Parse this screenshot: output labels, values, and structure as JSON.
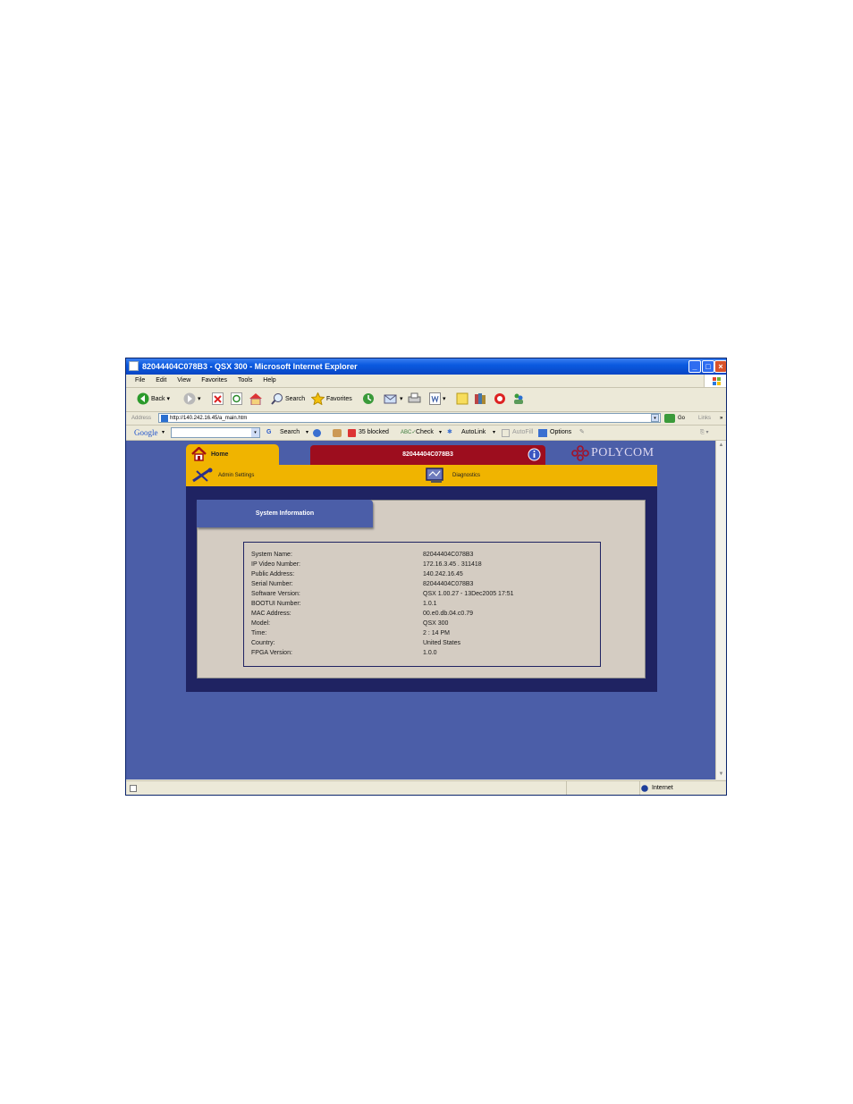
{
  "window": {
    "title": "82044404C078B3 - QSX 300 - Microsoft Internet Explorer",
    "min": "_",
    "max": "□",
    "close": "×"
  },
  "menu": [
    "File",
    "Edit",
    "View",
    "Favorites",
    "Tools",
    "Help"
  ],
  "toolbar": {
    "back": "Back",
    "search": "Search",
    "favorites": "Favorites"
  },
  "address": {
    "label": "Address",
    "url": "http://140.242.16.45/a_main.htm",
    "go": "Go",
    "links": "Links",
    "more": "»"
  },
  "google_bar": {
    "brand": "Google",
    "search": "Search",
    "blocked": "35 blocked",
    "check": "Check",
    "autolink": "AutoLink",
    "autofill": "AutoFill",
    "options": "Options"
  },
  "status": {
    "zone": "Internet"
  },
  "app": {
    "home_tab": "Home",
    "system_tab": "82044404C078B3",
    "logo": "POLYCOM",
    "nav": {
      "admin": "Admin Settings",
      "diagnostics": "Diagnostics"
    },
    "section_title": "System Information",
    "info": [
      {
        "label": "System Name:",
        "value": "82044404C078B3"
      },
      {
        "label": "IP Video Number:",
        "value": "172.16.3.45 . 311418"
      },
      {
        "label": "Public Address:",
        "value": "140.242.16.45"
      },
      {
        "label": "Serial Number:",
        "value": "82044404C078B3"
      },
      {
        "label": "Software Version:",
        "value": "QSX 1.00.27 - 13Dec2005 17:51"
      },
      {
        "label": "BOOTUI Number:",
        "value": "1.0.1"
      },
      {
        "label": "MAC Address:",
        "value": "00.e0.db.04.c0.79"
      },
      {
        "label": "Model:",
        "value": "QSX 300"
      },
      {
        "label": "Time:",
        "value": "2 : 14 PM"
      },
      {
        "label": "Country:",
        "value": "United States"
      },
      {
        "label": "FPGA Version:",
        "value": "1.0.0"
      }
    ]
  },
  "colors": {
    "page_bg": "#4b5ea8",
    "gold": "#f0b400",
    "crimson": "#9d0d1e",
    "navy": "#1f2362",
    "panel_gray": "#d4ccc2"
  }
}
